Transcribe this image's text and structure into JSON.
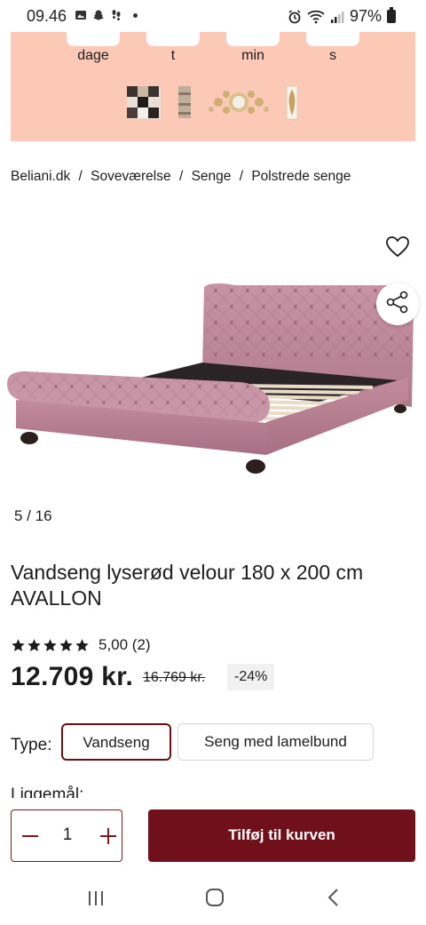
{
  "status_bar": {
    "time": "09.46",
    "battery": "97%",
    "notification_icons": [
      "image-icon",
      "snapchat-icon",
      "footsteps-icon",
      "dot-icon"
    ],
    "system_icons": [
      "alarm-icon",
      "wifi-icon",
      "signal-icon",
      "battery-icon"
    ]
  },
  "promo": {
    "countdown_labels": [
      "dage",
      "t",
      "min",
      "s"
    ],
    "thumbnails": [
      "checkered-tile-thumbnail",
      "wall-panel-thumbnail",
      "gold-mirror-thumbnail",
      "feather-art-thumbnail"
    ]
  },
  "breadcrumb": {
    "items": [
      "Beliani.dk",
      "Soveværelse",
      "Senge",
      "Polstrede senge"
    ],
    "separator": "/"
  },
  "gallery": {
    "pager": "5 / 16",
    "product_color": "#c48a9c"
  },
  "product": {
    "title": "Vandseng lyserød velour 180 x 200 cm AVALLON",
    "rating_stars": 5,
    "rating_text": "5,00 (2)",
    "price": "12.709 kr.",
    "old_price": "16.769 kr.",
    "discount": "-24%"
  },
  "variants": {
    "type_label": "Type:",
    "options": [
      "Vandseng",
      "Seng med lamelbund"
    ],
    "selected": "Vandseng",
    "size_label": "Liggemål:"
  },
  "cart": {
    "quantity": "1",
    "add_label": "Tilføj til kurven",
    "accent_color": "#70101a"
  },
  "colors": {
    "banner_bg": "#fbc9b6",
    "accent": "#70101a"
  }
}
